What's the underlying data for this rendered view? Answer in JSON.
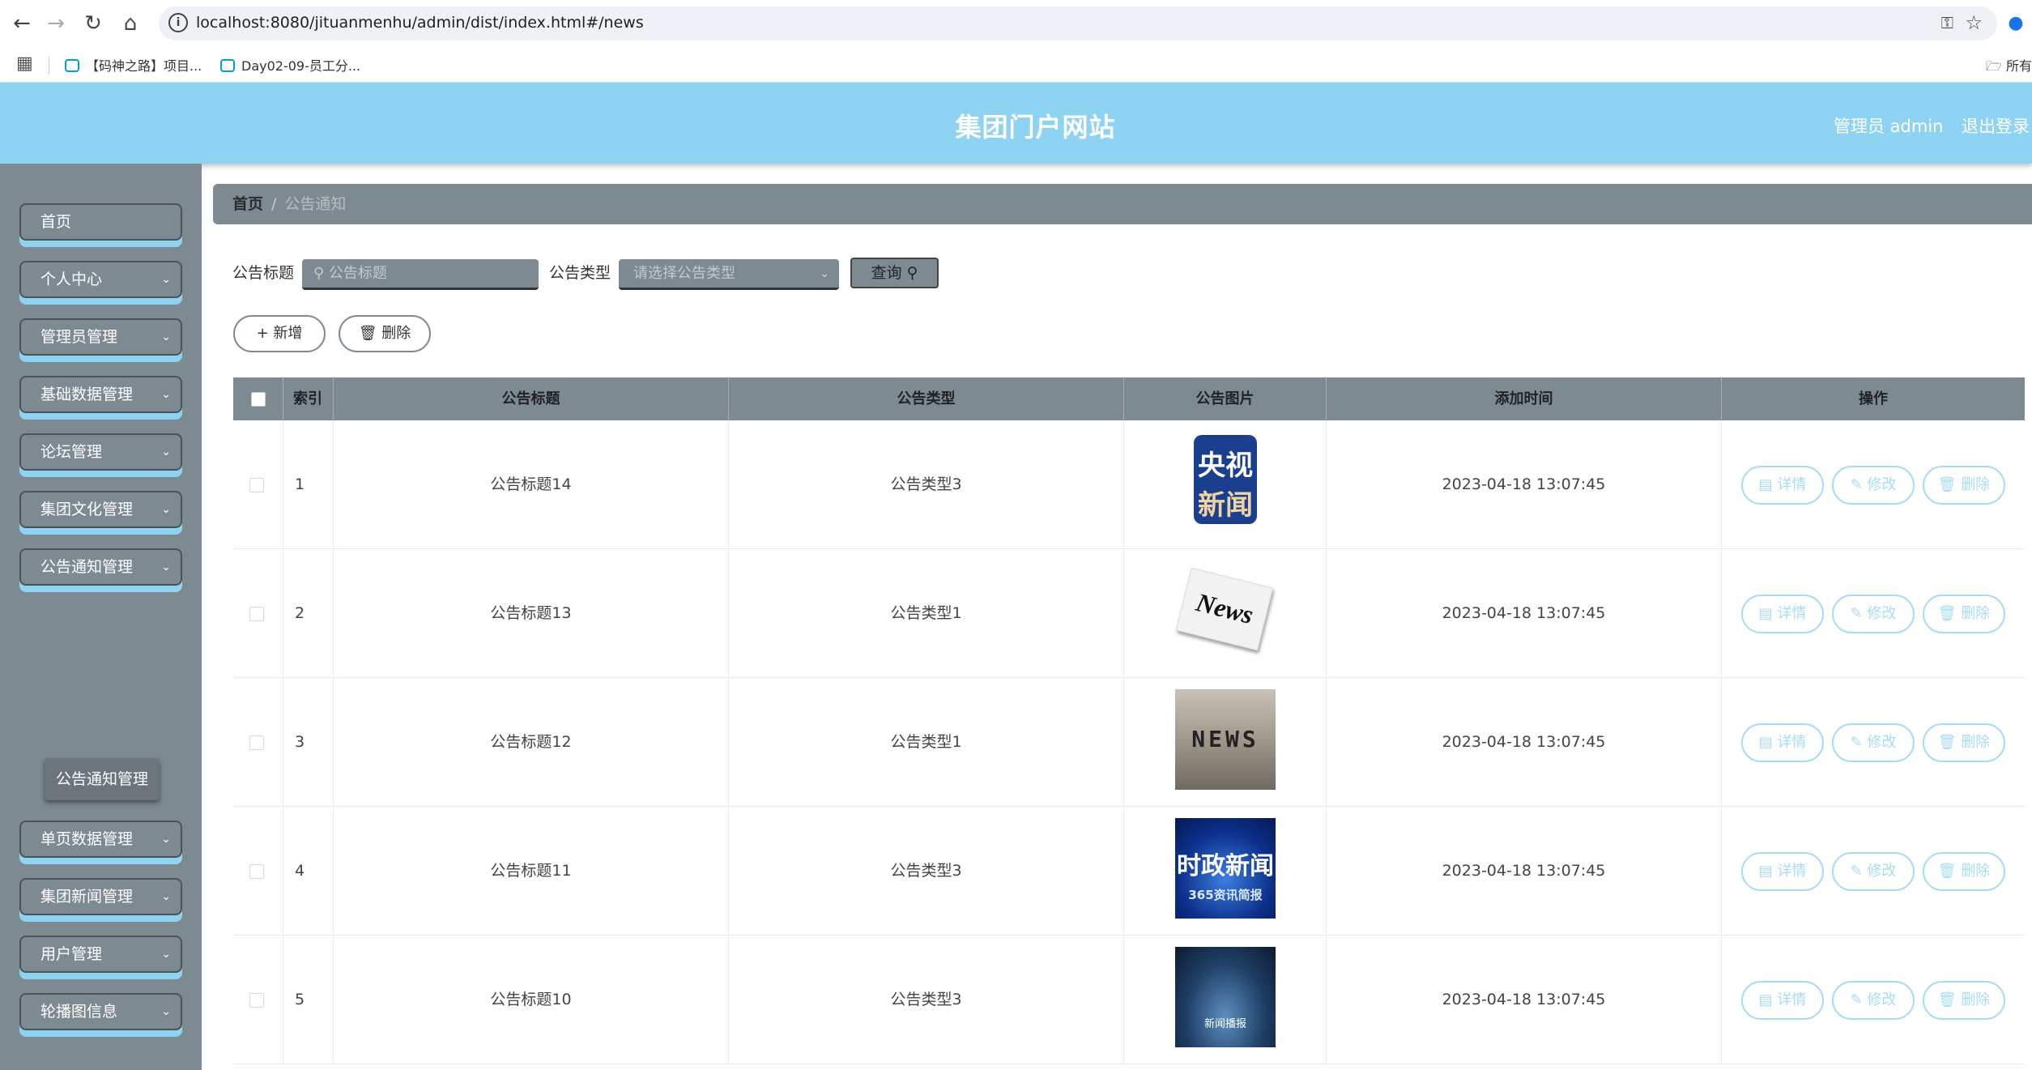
{
  "browser": {
    "url": "localhost:8080/jituanmenhu/admin/dist/index.html#/news",
    "bookmarks": [
      "【码神之路】项目...",
      "Day02-09-员工分..."
    ],
    "folder_label": "所有"
  },
  "header": {
    "title": "集团门户网站",
    "admin_label": "管理员 admin",
    "logout_label": "退出登录"
  },
  "sidebar": {
    "items": [
      {
        "label": "首页"
      },
      {
        "label": "个人中心"
      },
      {
        "label": "管理员管理"
      },
      {
        "label": "基础数据管理"
      },
      {
        "label": "论坛管理"
      },
      {
        "label": "集团文化管理"
      },
      {
        "label": "公告通知管理"
      },
      {
        "label": "单页数据管理"
      },
      {
        "label": "集团新闻管理"
      },
      {
        "label": "用户管理"
      },
      {
        "label": "轮播图信息"
      }
    ],
    "submenu_active": "公告通知管理"
  },
  "breadcrumb": {
    "home": "首页",
    "separator": "/",
    "current": "公告通知"
  },
  "search": {
    "title_label": "公告标题",
    "title_placeholder": "公告标题",
    "type_label": "公告类型",
    "type_placeholder": "请选择公告类型",
    "query_label": "查询"
  },
  "actions": {
    "add_label": "新增",
    "delete_label": "删除"
  },
  "table": {
    "columns": [
      "索引",
      "公告标题",
      "公告类型",
      "公告图片",
      "添加时间",
      "操作"
    ],
    "rows": [
      {
        "index": "1",
        "title": "公告标题14",
        "type": "公告类型3",
        "image": "cctv-news",
        "time": "2023-04-18 13:07:45"
      },
      {
        "index": "2",
        "title": "公告标题13",
        "type": "公告类型1",
        "image": "news-newspaper",
        "time": "2023-04-18 13:07:45"
      },
      {
        "index": "3",
        "title": "公告标题12",
        "type": "公告类型1",
        "image": "news-blocks",
        "time": "2023-04-18 13:07:45"
      },
      {
        "index": "4",
        "title": "公告标题11",
        "type": "公告类型3",
        "image": "politics-news",
        "time": "2023-04-18 13:07:45"
      },
      {
        "index": "5",
        "title": "公告标题10",
        "type": "公告类型3",
        "image": "news-stage",
        "time": "2023-04-18 13:07:45"
      }
    ],
    "op_labels": {
      "detail": "详情",
      "edit": "修改",
      "delete": "删除"
    }
  },
  "thumb_text": {
    "cctv": [
      "央视",
      "新闻"
    ],
    "newspaper": "News",
    "blocks": "NEWS",
    "politics": [
      "时政新闻",
      "365资讯简报"
    ],
    "stage": "新闻播报"
  },
  "colors": {
    "header_bg": "#8fd3f2",
    "sidebar_bg": "#7e8a92",
    "accent": "#8fd3f2",
    "op_button": "#a7dcf2"
  }
}
